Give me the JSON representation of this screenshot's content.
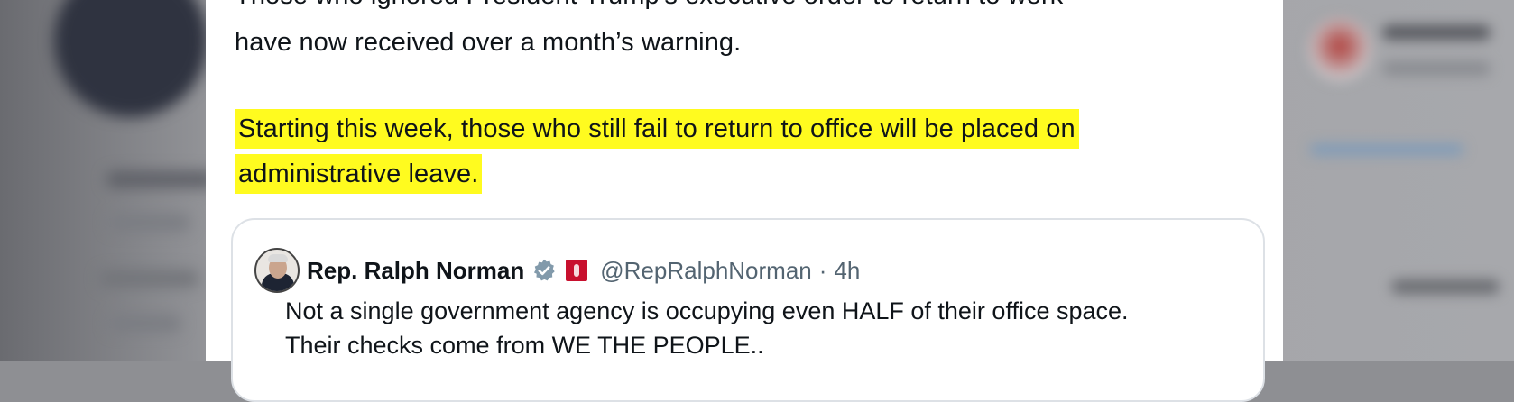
{
  "tweet": {
    "line_cut": "Those who ignored President Trump's executive order to return to work",
    "line_warning": "have now received over a month’s warning.",
    "highlight_line1": "Starting this week, those who still fail to return to office will be placed on",
    "highlight_line2": "administrative leave."
  },
  "quote": {
    "name": "Rep. Ralph Norman",
    "handle": "@RepRalphNorman",
    "separator": "·",
    "time": "4h",
    "body_line1": "Not a single government agency is occupying even HALF of their office space.",
    "body_line2": "Their checks come from WE THE PEOPLE.."
  },
  "colors": {
    "highlight": "#fffb1f",
    "verified_badge": "#829aab",
    "flag": "#c8102e"
  },
  "icons": {
    "verified": "verified-badge-icon",
    "flag": "congress-flag-icon"
  }
}
